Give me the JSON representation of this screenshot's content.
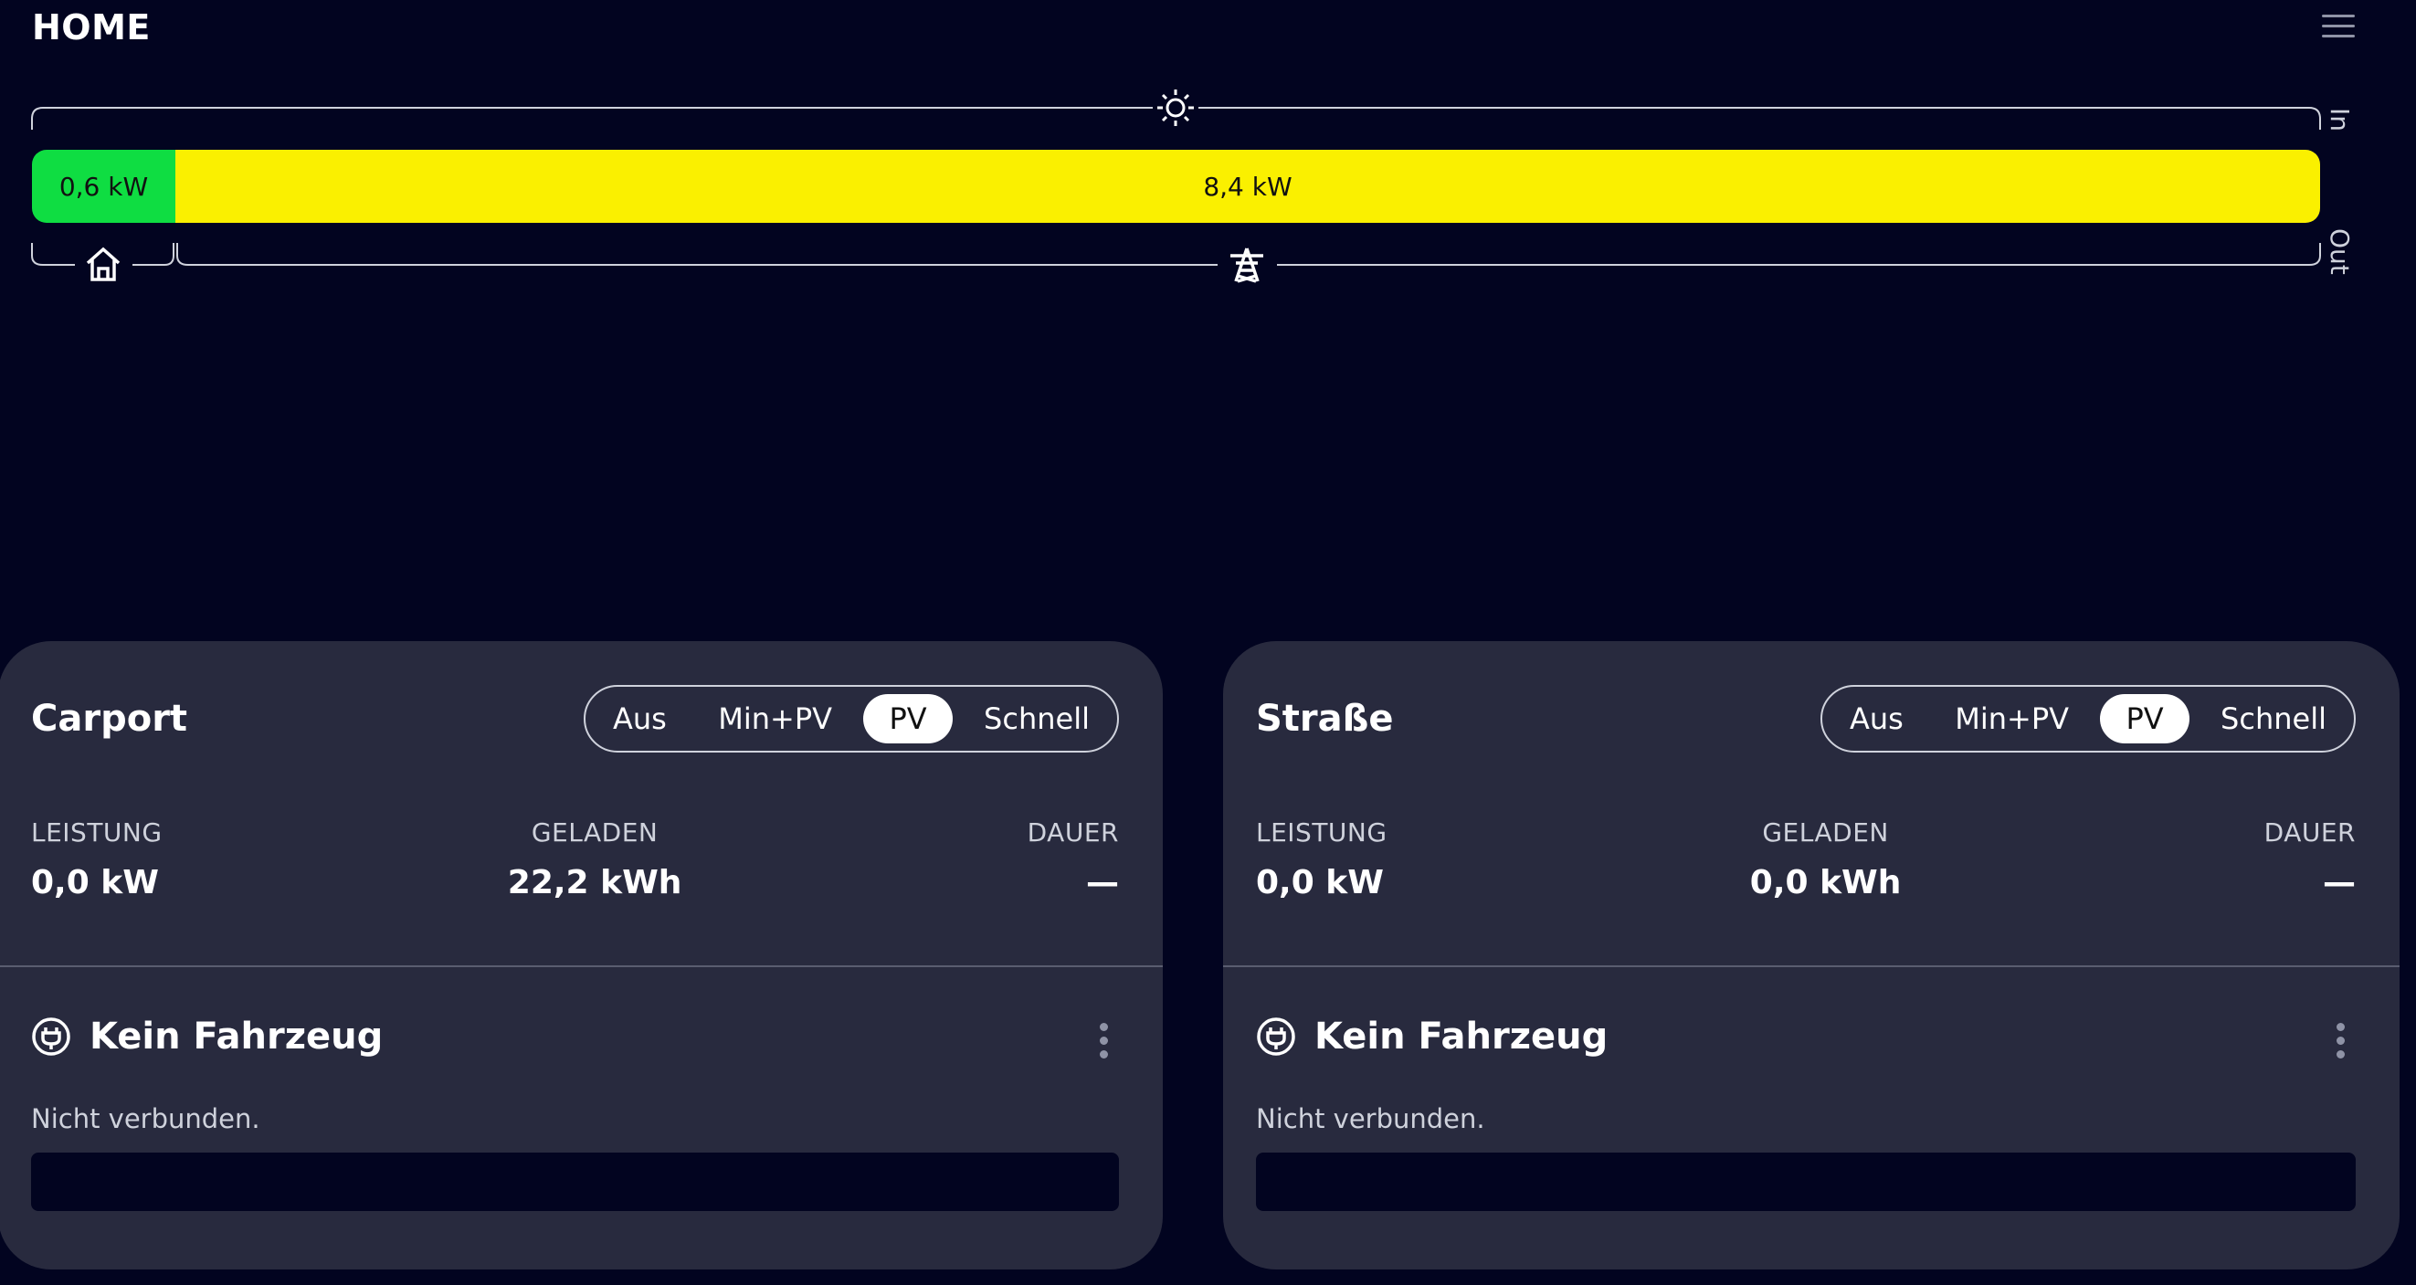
{
  "header": {
    "title": "HOME",
    "menu_icon": "hamburger-menu-icon"
  },
  "energy_flow": {
    "home_value": "0,6 kW",
    "grid_value": "8,4 kW",
    "home_fraction": 0.067,
    "in_label": "In",
    "out_label": "Out",
    "colors": {
      "home": "#0fdd42",
      "grid": "#faf000"
    },
    "icons": [
      "sun-icon",
      "home-icon",
      "power-pylon-icon"
    ]
  },
  "loadpoints": [
    {
      "name": "Carport",
      "modes": [
        "Aus",
        "Min+PV",
        "PV",
        "Schnell"
      ],
      "active_mode": "PV",
      "metrics": {
        "power_label": "LEISTUNG",
        "power_value": "0,0 kW",
        "charged_label": "GELADEN",
        "charged_value": "22,2 kWh",
        "duration_label": "DAUER",
        "duration_value": "—"
      },
      "vehicle": {
        "name": "Kein Fahrzeug",
        "status": "Nicht verbunden."
      }
    },
    {
      "name": "Straße",
      "modes": [
        "Aus",
        "Min+PV",
        "PV",
        "Schnell"
      ],
      "active_mode": "PV",
      "metrics": {
        "power_label": "LEISTUNG",
        "power_value": "0,0 kW",
        "charged_label": "GELADEN",
        "charged_value": "0,0 kWh",
        "duration_label": "DAUER",
        "duration_value": "—"
      },
      "vehicle": {
        "name": "Kein Fahrzeug",
        "status": "Nicht verbunden."
      }
    }
  ]
}
